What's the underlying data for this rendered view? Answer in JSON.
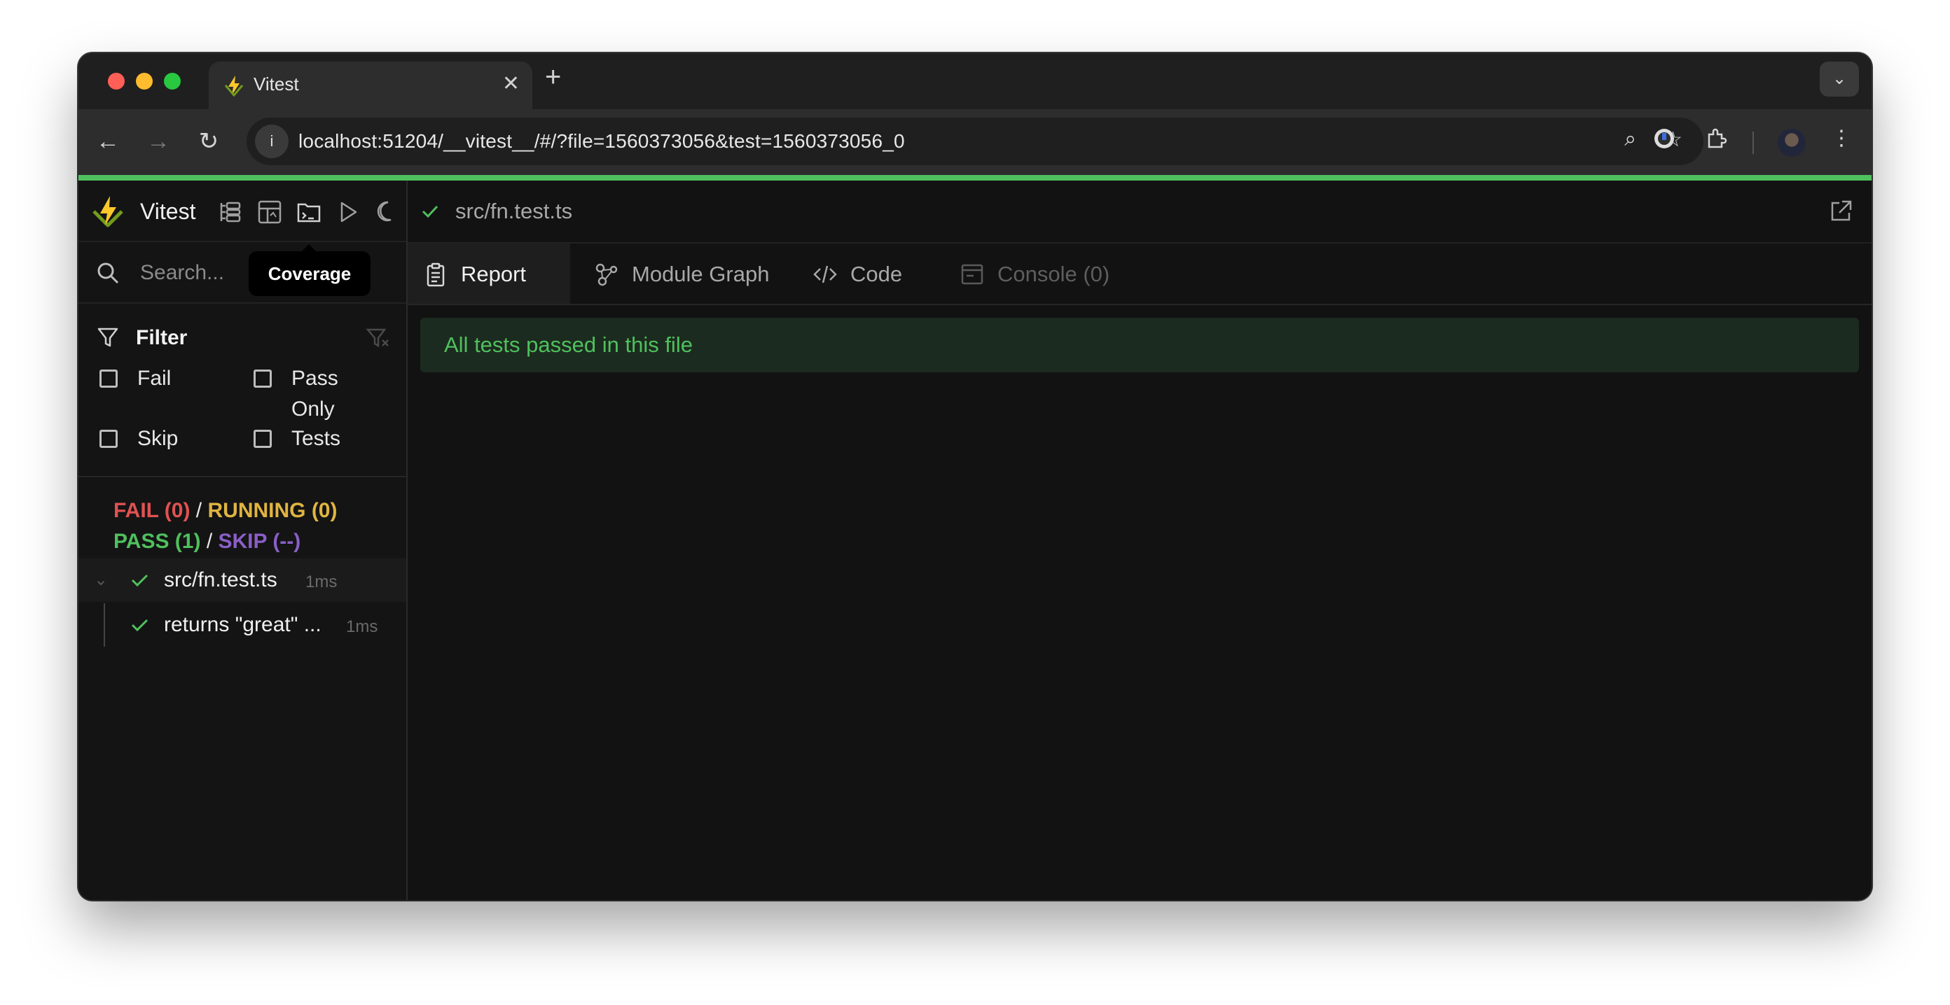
{
  "browser": {
    "tab_title": "Vitest",
    "tab_close": "✕",
    "new_tab": "+",
    "url": "localhost:51204/__vitest__/#/?file=1560373056&test=1560373056_0"
  },
  "sidebar": {
    "brand": "Vitest",
    "search_placeholder": "Search...",
    "tooltip": "Coverage",
    "filter": {
      "title": "Filter",
      "fail": "Fail",
      "pass": "Pass",
      "skip": "Skip",
      "only_tests_line1": "Only",
      "only_tests_line2": "Tests"
    },
    "summary": {
      "fail": "FAIL (0)",
      "running": "RUNNING (0)",
      "pass": "PASS (1)",
      "skip": "SKIP (--)",
      "slash": "/"
    },
    "tree": {
      "file_name": "src/fn.test.ts",
      "file_duration": "1ms",
      "test_name": "returns \"great\" ...",
      "test_duration": "1ms"
    }
  },
  "main": {
    "file_path": "src/fn.test.ts",
    "tabs": [
      {
        "label": "Report",
        "icon": "clipboard-icon"
      },
      {
        "label": "Module Graph",
        "icon": "graph-icon"
      },
      {
        "label": "Code",
        "icon": "code-icon"
      },
      {
        "label": "Console (0)",
        "icon": "console-icon"
      }
    ],
    "banner": "All tests passed in this file"
  },
  "colors": {
    "accent_green": "#4fc05e",
    "fail_red": "#e05252",
    "running_yellow": "#e0b441",
    "skip_purple": "#8a5fc7"
  }
}
